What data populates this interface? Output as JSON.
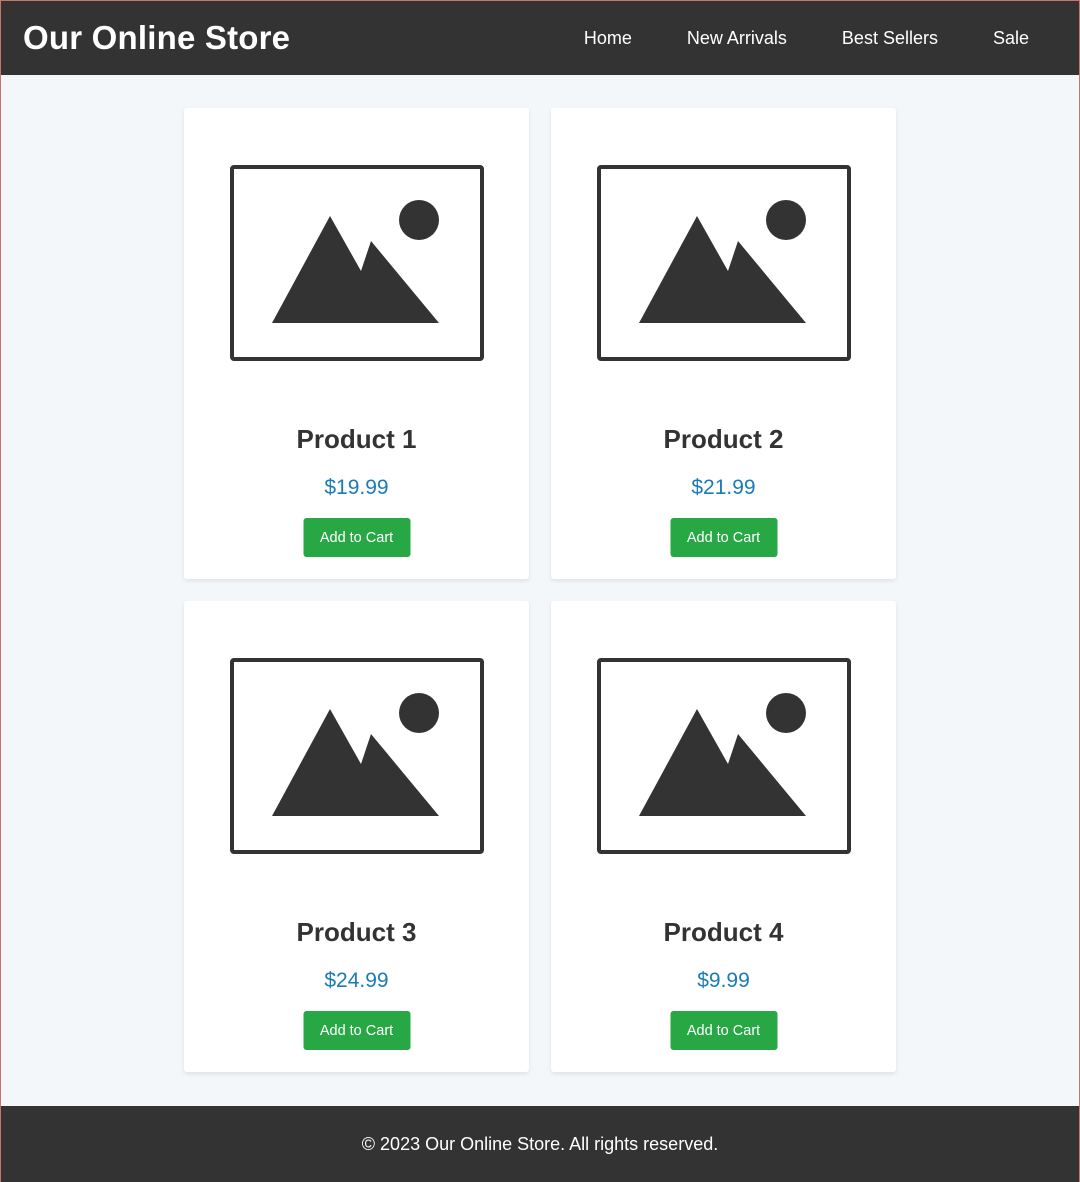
{
  "header": {
    "site_title": "Our Online Store",
    "nav": [
      {
        "label": "Home"
      },
      {
        "label": "New Arrivals"
      },
      {
        "label": "Best Sellers"
      },
      {
        "label": "Sale"
      }
    ]
  },
  "products": [
    {
      "name": "Product 1",
      "price": "$19.99",
      "button_label": "Add to Cart",
      "image_icon": "image-placeholder-icon"
    },
    {
      "name": "Product 2",
      "price": "$21.99",
      "button_label": "Add to Cart",
      "image_icon": "image-placeholder-icon"
    },
    {
      "name": "Product 3",
      "price": "$24.99",
      "button_label": "Add to Cart",
      "image_icon": "image-placeholder-icon"
    },
    {
      "name": "Product 4",
      "price": "$9.99",
      "button_label": "Add to Cart",
      "image_icon": "image-placeholder-icon"
    }
  ],
  "footer": {
    "copyright": "© 2023 Our Online Store. All rights reserved."
  },
  "colors": {
    "header_bg": "#333333",
    "page_bg": "#f4f7fa",
    "price": "#1a7bb8",
    "button_bg": "#28a745",
    "text_dark": "#333333"
  }
}
